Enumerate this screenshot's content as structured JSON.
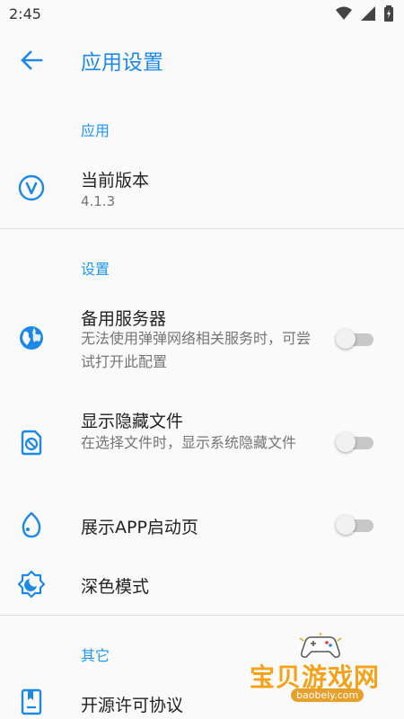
{
  "status_bar": {
    "time": "2:45"
  },
  "app_bar": {
    "title": "应用设置"
  },
  "sections": {
    "app": {
      "header": "应用",
      "version": {
        "title": "当前版本",
        "value": "4.1.3"
      }
    },
    "settings": {
      "header": "设置",
      "backup_server": {
        "title": "备用服务器",
        "sub": "无法使用弹弹网络相关服务时，可尝试打开此配置",
        "enabled": false
      },
      "hidden_files": {
        "title": "显示隐藏文件",
        "sub": "在选择文件时，显示系统隐藏文件",
        "enabled": false
      },
      "splash": {
        "title": "展示APP启动页",
        "enabled": false
      },
      "dark_mode": {
        "title": "深色模式"
      }
    },
    "other": {
      "header": "其它",
      "license": {
        "title": "开源许可协议"
      }
    }
  },
  "watermark": {
    "brand": "宝贝游戏网",
    "url": "baobeiy.com"
  },
  "colors": {
    "accent": "#1e88e5",
    "icon": "#1e88e5",
    "divider": "#dedede"
  }
}
